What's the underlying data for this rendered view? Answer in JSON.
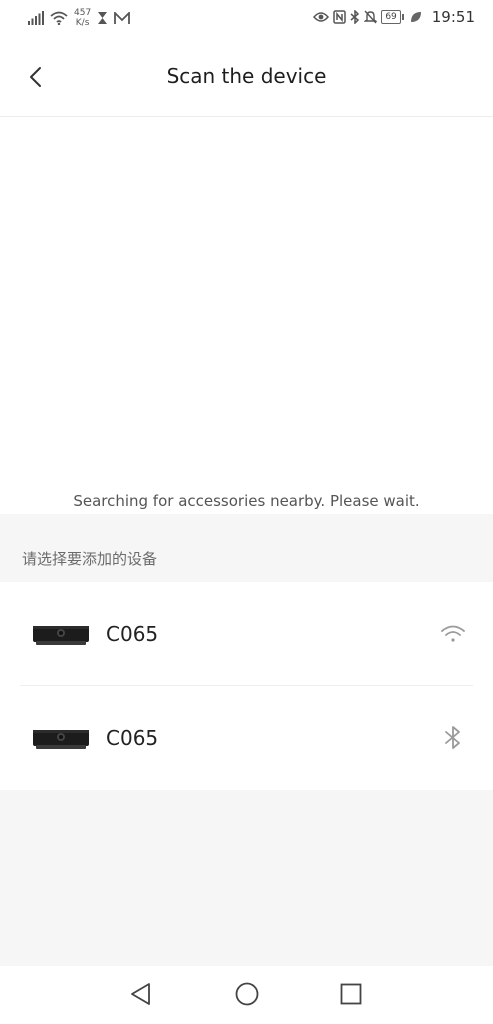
{
  "status_bar": {
    "net_speed_value": "457",
    "net_speed_unit": "K/s",
    "battery": "69",
    "time": "19:51"
  },
  "header": {
    "title": "Scan the device"
  },
  "scan": {
    "status_text": "Searching for accessories nearby. Please wait.",
    "section_label": "请选择要添加的设备"
  },
  "devices": [
    {
      "name": "C065",
      "connection_icon": "wifi-icon"
    },
    {
      "name": "C065",
      "connection_icon": "bluetooth-icon"
    }
  ],
  "colors": {
    "section_background": "#f6f6f6",
    "icon_gray": "#9a9a9a"
  }
}
